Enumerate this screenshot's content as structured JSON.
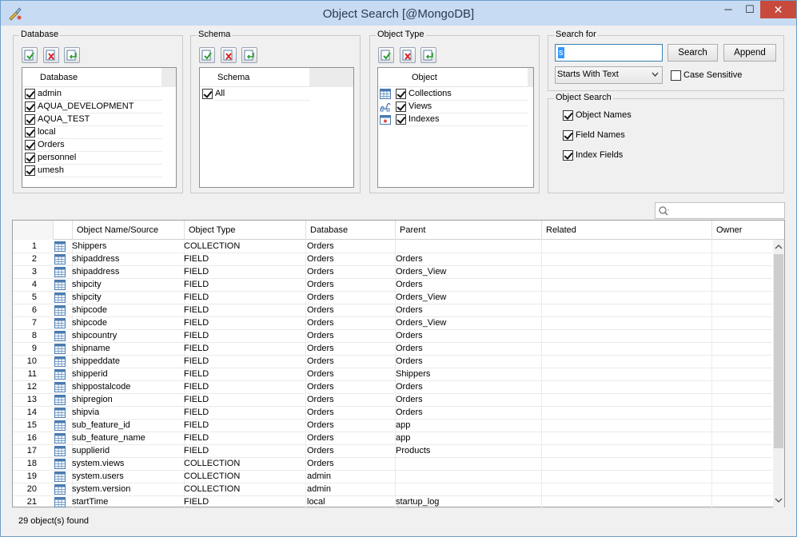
{
  "window": {
    "title": "Object Search [@MongoDB]",
    "minimize_glyph": "─",
    "maximize_glyph": "☐",
    "close_glyph": "✕"
  },
  "database_panel": {
    "label": "Database",
    "column": "Database",
    "items": [
      {
        "label": "admin",
        "checked": true
      },
      {
        "label": "AQUA_DEVELOPMENT",
        "checked": true
      },
      {
        "label": "AQUA_TEST",
        "checked": true
      },
      {
        "label": "local",
        "checked": true
      },
      {
        "label": "Orders",
        "checked": true
      },
      {
        "label": "personnel",
        "checked": true
      },
      {
        "label": "umesh",
        "checked": true
      }
    ]
  },
  "schema_panel": {
    "label": "Schema",
    "column": "Schema",
    "items": [
      {
        "label": "All",
        "checked": true
      }
    ]
  },
  "object_type_panel": {
    "label": "Object Type",
    "column": "Object",
    "items": [
      {
        "label": "Collections",
        "checked": true,
        "icon": "collection-icon"
      },
      {
        "label": "Views",
        "checked": true,
        "icon": "view-icon"
      },
      {
        "label": "Indexes",
        "checked": true,
        "icon": "index-icon"
      }
    ]
  },
  "search_for": {
    "label": "Search for",
    "value": "s",
    "search_button": "Search",
    "append_button": "Append",
    "match_mode": "Starts With Text",
    "case_sensitive_label": "Case Sensitive",
    "case_sensitive": false
  },
  "object_search": {
    "label": "Object Search",
    "options": [
      {
        "label": "Object Names",
        "checked": true
      },
      {
        "label": "Field Names",
        "checked": true
      },
      {
        "label": "Index Fields",
        "checked": true
      }
    ]
  },
  "filter": {
    "placeholder": "",
    "icon": "search-icon"
  },
  "results": {
    "columns": [
      "Object Name/Source",
      "Object Type",
      "Database",
      "Parent",
      "Related",
      "Owner"
    ],
    "rows": [
      {
        "n": "1",
        "name": "Shippers",
        "type": "COLLECTION",
        "db": "Orders",
        "parent": ""
      },
      {
        "n": "2",
        "name": "shipaddress",
        "type": "FIELD",
        "db": "Orders",
        "parent": "Orders"
      },
      {
        "n": "3",
        "name": "shipaddress",
        "type": "FIELD",
        "db": "Orders",
        "parent": "Orders_View"
      },
      {
        "n": "4",
        "name": "shipcity",
        "type": "FIELD",
        "db": "Orders",
        "parent": "Orders"
      },
      {
        "n": "5",
        "name": "shipcity",
        "type": "FIELD",
        "db": "Orders",
        "parent": "Orders_View"
      },
      {
        "n": "6",
        "name": "shipcode",
        "type": "FIELD",
        "db": "Orders",
        "parent": "Orders"
      },
      {
        "n": "7",
        "name": "shipcode",
        "type": "FIELD",
        "db": "Orders",
        "parent": "Orders_View"
      },
      {
        "n": "8",
        "name": "shipcountry",
        "type": "FIELD",
        "db": "Orders",
        "parent": "Orders"
      },
      {
        "n": "9",
        "name": "shipname",
        "type": "FIELD",
        "db": "Orders",
        "parent": "Orders"
      },
      {
        "n": "10",
        "name": "shippeddate",
        "type": "FIELD",
        "db": "Orders",
        "parent": "Orders"
      },
      {
        "n": "11",
        "name": "shipperid",
        "type": "FIELD",
        "db": "Orders",
        "parent": "Shippers"
      },
      {
        "n": "12",
        "name": "shippostalcode",
        "type": "FIELD",
        "db": "Orders",
        "parent": "Orders"
      },
      {
        "n": "13",
        "name": "shipregion",
        "type": "FIELD",
        "db": "Orders",
        "parent": "Orders"
      },
      {
        "n": "14",
        "name": "shipvia",
        "type": "FIELD",
        "db": "Orders",
        "parent": "Orders"
      },
      {
        "n": "15",
        "name": "sub_feature_id",
        "type": "FIELD",
        "db": "Orders",
        "parent": "app"
      },
      {
        "n": "16",
        "name": "sub_feature_name",
        "type": "FIELD",
        "db": "Orders",
        "parent": "app"
      },
      {
        "n": "17",
        "name": "supplierid",
        "type": "FIELD",
        "db": "Orders",
        "parent": "Products"
      },
      {
        "n": "18",
        "name": "system.views",
        "type": "COLLECTION",
        "db": "Orders",
        "parent": ""
      },
      {
        "n": "19",
        "name": "system.users",
        "type": "COLLECTION",
        "db": "admin",
        "parent": ""
      },
      {
        "n": "20",
        "name": "system.version",
        "type": "COLLECTION",
        "db": "admin",
        "parent": ""
      },
      {
        "n": "21",
        "name": "startTime",
        "type": "FIELD",
        "db": "local",
        "parent": "startup_log"
      }
    ]
  },
  "status": "29 object(s) found"
}
